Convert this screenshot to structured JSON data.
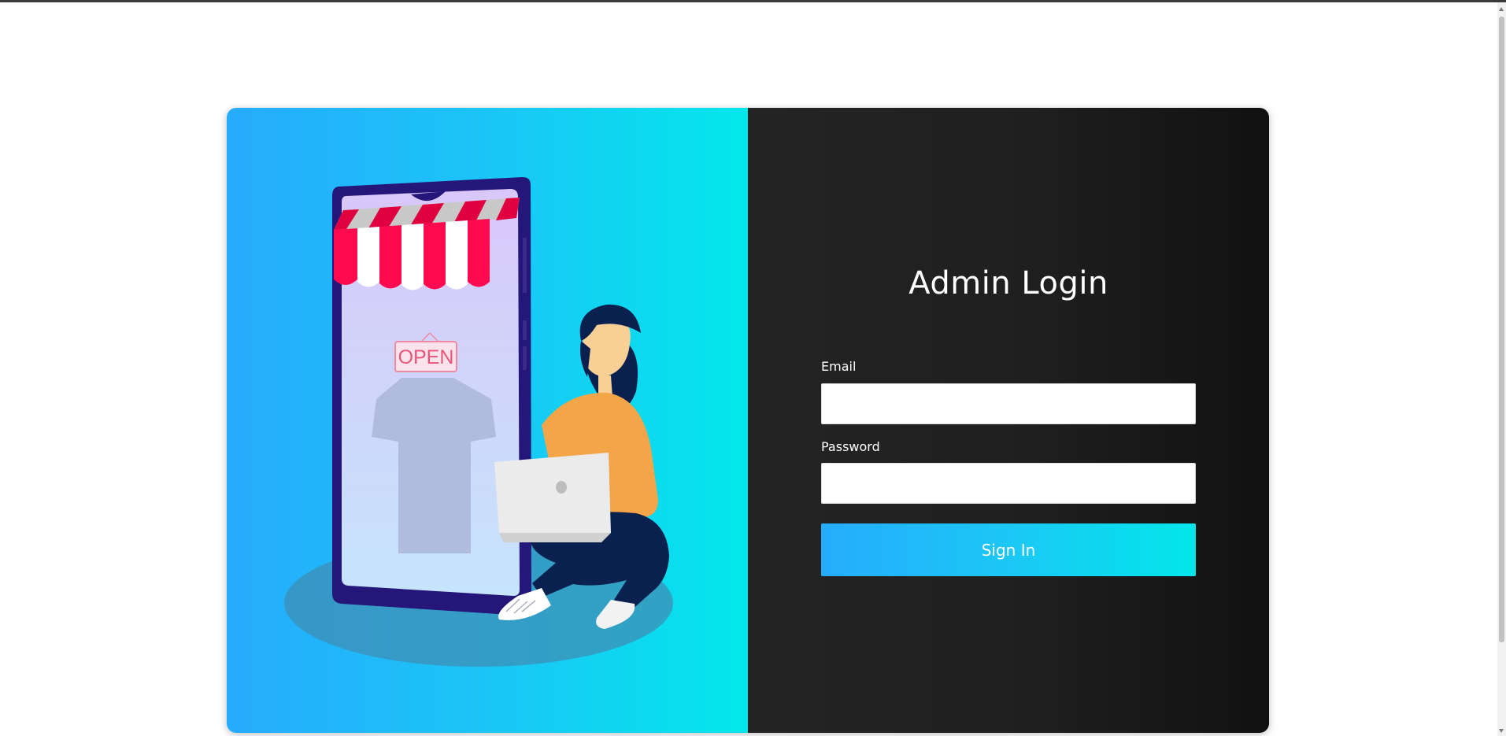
{
  "login": {
    "title": "Admin Login",
    "email_label": "Email",
    "email_value": "",
    "password_label": "Password",
    "password_value": "",
    "submit_label": "Sign In"
  },
  "illustration": {
    "sign_text": "OPEN"
  },
  "colors": {
    "accent_start": "#26abfd",
    "accent_end": "#03e7eb",
    "dark_panel": "#1f1f1f"
  }
}
